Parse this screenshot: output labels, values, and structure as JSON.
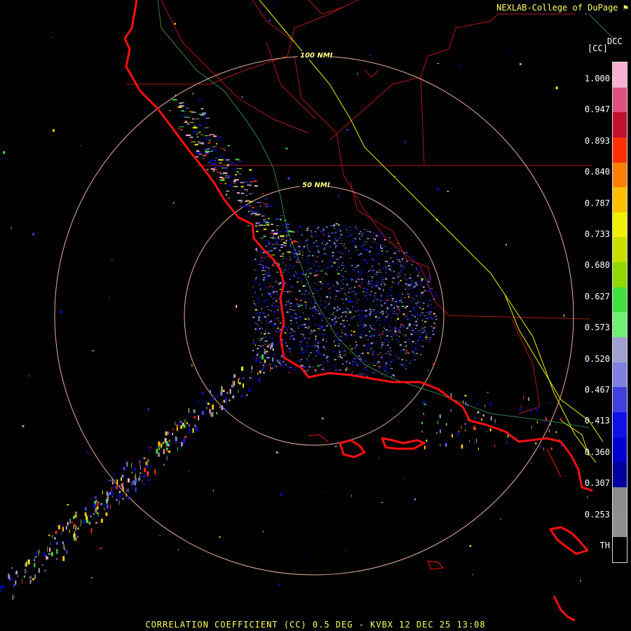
{
  "credit": "NEXLAB-College of DuPage",
  "credit_icon": "flag-icon",
  "product_code": "DCC",
  "units_label": "[CC]",
  "caption": "CORRELATION COEFFICIENT (CC) 0.5 DEG - KVBX 12 DEC 25 13:08",
  "range_rings": [
    {
      "label": "100 NMI"
    },
    {
      "label": "50 NMI"
    }
  ],
  "legend": {
    "ticks": [
      "1.000",
      "0.947",
      "0.893",
      "0.840",
      "0.787",
      "0.733",
      "0.680",
      "0.627",
      "0.573",
      "0.520",
      "0.467",
      "0.413",
      "0.360",
      "0.307",
      "0.253",
      "TH"
    ],
    "colors": [
      "#f8b0d0",
      "#e05080",
      "#c01030",
      "#ff3000",
      "#ff8000",
      "#ffc000",
      "#f0f000",
      "#c8e000",
      "#90d800",
      "#40e040",
      "#70f070",
      "#a0a0d0",
      "#8080e0",
      "#4040e0",
      "#1010e8",
      "#0000d0",
      "#0000a0",
      "#8c8c8c",
      "#909090",
      "#000000"
    ]
  },
  "colors": {
    "coast": "#ff1010",
    "county": "#b01818",
    "highway": "#f0f000",
    "river": "#40a060",
    "ring": "#e8b0a0"
  }
}
